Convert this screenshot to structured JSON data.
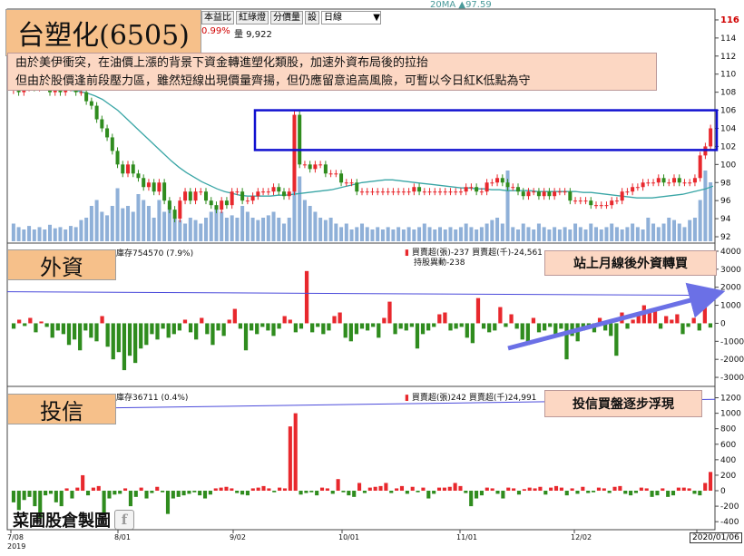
{
  "title": "台塑化(6505)",
  "note_lines": [
    "由於美伊衝突，在油價上漲的背景下資金轉進塑化類股，加速外資布局後的拉抬",
    "但由於股價逢前段壓力區，雖然短線出現價量齊揚，但仍應留意追高風險，可暫以今日紅K低點為守"
  ],
  "toolbar": {
    "btn1": "本益比",
    "btn2": "紅綠燈",
    "btn3": "分價量",
    "btn4": "設",
    "period": "日線",
    "period_arrow": "▼"
  },
  "header_info": {
    "pct": "0.99%",
    "vol": "量 9,922",
    "ma_label": "20MA ▲97.59"
  },
  "panels": {
    "foreign": {
      "label": "外資",
      "stock": "庫存754570 (7.9%)",
      "legend1": "買賣超(張)-237 買賣超(千)-24,561",
      "legend2": "持股異動-238",
      "callout": "站上月線後外資轉買"
    },
    "trust": {
      "label": "投信",
      "stock": "庫存36711 (0.4%)",
      "legend1": "買賣超(張)242 買賣超(千)24,991",
      "callout": "投信買盤逐步浮現"
    }
  },
  "watermark": "菜圃股倉製圖",
  "watermark_icon": "facebook-icon",
  "last_date": "2020/01/06",
  "colors": {
    "up": "#e8282d",
    "down": "#2f8c1e",
    "ma": "#3aa6a6",
    "volume": "#8fb0d8",
    "holding": "#4b4bdb",
    "box": "#1010d0",
    "arrow": "#6b70e6",
    "price_tag": "#d00000"
  },
  "chart_data": [
    {
      "type": "candlestick",
      "title": "",
      "x_ticks": [
        "7/08\n2019",
        "8/01",
        "9/02",
        "10/01",
        "11/01",
        "12/02",
        "2020"
      ],
      "y_ticks": [
        92,
        94,
        96,
        98,
        100,
        102,
        104,
        106,
        108,
        110,
        112,
        114,
        116
      ],
      "ylim": [
        91.5,
        117
      ],
      "last_price": 116,
      "close": [
        108.5,
        108,
        108.5,
        109,
        108.5,
        109,
        108.8,
        108,
        108.5,
        108,
        108.5,
        108.5,
        108,
        108,
        107,
        106.5,
        105,
        104,
        103,
        101.5,
        100,
        99,
        100,
        99,
        98.5,
        97.5,
        98,
        97,
        98,
        96,
        95,
        94,
        96,
        97,
        96,
        97,
        97,
        96,
        95.5,
        95,
        96,
        95.5,
        97,
        97,
        96,
        96,
        96.5,
        97,
        97,
        97,
        97.5,
        97,
        96.5,
        97,
        105.5,
        100,
        100,
        99.5,
        100,
        100,
        99,
        99,
        99,
        98,
        98,
        98,
        97,
        97,
        97,
        97,
        97,
        97,
        97,
        97,
        97,
        97,
        97,
        97.5,
        97,
        97,
        97,
        97,
        97,
        97,
        97,
        97,
        97,
        97.5,
        97.5,
        97,
        97,
        98,
        98,
        98.5,
        98,
        97.5,
        97.5,
        97,
        96.5,
        97,
        97,
        96.5,
        97,
        96.5,
        97,
        97,
        97,
        96,
        96,
        96,
        96,
        95.5,
        95.5,
        95.5,
        95.5,
        96,
        96,
        97,
        97,
        97.5,
        97.5,
        98,
        98,
        98,
        98.5,
        98,
        98,
        98.5,
        98,
        98,
        98,
        98.5,
        101,
        102,
        104
      ],
      "ma20": [
        108.8,
        108.7,
        108.6,
        108.6,
        108.5,
        108.5,
        108.4,
        108.3,
        108.2,
        108.1,
        107.9,
        107.6,
        107.2,
        106.6,
        106,
        105.2,
        104.4,
        103.6,
        102.8,
        102,
        101.2,
        100.4,
        99.7,
        99.1,
        98.6,
        98.1,
        97.7,
        97.3,
        97,
        96.8,
        96.6,
        96.5,
        96.5,
        96.5,
        96.5,
        96.6,
        96.6,
        96.7,
        96.8,
        96.9,
        97,
        97.1,
        97.2,
        97.4,
        97.6,
        97.8,
        98,
        98.1,
        98.2,
        98.3,
        98.3,
        98.2,
        98.1,
        98,
        97.9,
        97.8,
        97.7,
        97.6,
        97.5,
        97.4,
        97.4,
        97.3,
        97.3,
        97.2,
        97.2,
        97.1,
        97.1,
        97.1,
        97.1,
        97,
        97,
        97,
        97,
        97,
        97,
        96.9,
        96.9,
        96.8,
        96.7,
        96.6,
        96.5,
        96.4,
        96.3,
        96.3,
        96.3,
        96.4,
        96.5,
        96.6,
        96.7,
        96.9,
        97.1,
        97.3,
        97.6
      ],
      "volume_relative": [
        0.15,
        0.12,
        0.1,
        0.13,
        0.1,
        0.12,
        0.1,
        0.14,
        0.11,
        0.12,
        0.1,
        0.13,
        0.12,
        0.18,
        0.2,
        0.3,
        0.35,
        0.25,
        0.22,
        0.3,
        0.45,
        0.28,
        0.3,
        0.25,
        0.4,
        0.35,
        0.3,
        0.2,
        0.35,
        0.25,
        0.3,
        0.2,
        0.18,
        0.15,
        0.2,
        0.18,
        0.15,
        0.2,
        0.25,
        0.3,
        0.25,
        0.2,
        0.22,
        0.2,
        0.3,
        0.25,
        0.2,
        0.18,
        0.2,
        0.22,
        0.25,
        0.2,
        0.15,
        0.2,
        1.0,
        0.55,
        0.35,
        0.3,
        0.25,
        0.2,
        0.18,
        0.2,
        0.15,
        0.12,
        0.15,
        0.1,
        0.12,
        0.15,
        0.12,
        0.1,
        0.12,
        0.1,
        0.12,
        0.1,
        0.12,
        0.1,
        0.12,
        0.1,
        0.12,
        0.15,
        0.12,
        0.1,
        0.12,
        0.1,
        0.12,
        0.1,
        0.12,
        0.15,
        0.12,
        0.1,
        0.12,
        0.15,
        0.18,
        0.2,
        0.15,
        0.6,
        0.12,
        0.1,
        0.15,
        0.12,
        0.1,
        0.15,
        0.12,
        0.1,
        0.12,
        0.1,
        0.12,
        0.1,
        0.15,
        0.12,
        0.1,
        0.15,
        0.12,
        0.1,
        0.12,
        0.15,
        0.12,
        0.1,
        0.12,
        0.15,
        0.12,
        0.1,
        0.2,
        0.15,
        0.12,
        0.15,
        0.2,
        0.18,
        0.15,
        0.12,
        0.18,
        0.2,
        0.35,
        0.6,
        0.5
      ]
    },
    {
      "type": "bar",
      "title": "",
      "y_ticks": [
        -3000,
        -2000,
        -1000,
        0,
        1000,
        2000,
        3000,
        4000
      ],
      "ylim": [
        -3400,
        4300
      ],
      "values": [
        -300,
        200,
        -150,
        300,
        -500,
        100,
        -200,
        -800,
        -400,
        -600,
        -1200,
        -900,
        -1500,
        -400,
        -800,
        -1000,
        400,
        -1300,
        -2000,
        -1600,
        -2600,
        -1800,
        -2200,
        -1400,
        -1200,
        -600,
        -900,
        -300,
        -800,
        -600,
        -400,
        200,
        -500,
        -900,
        300,
        -600,
        -1200,
        -400,
        -700,
        200,
        800,
        -300,
        -1500,
        -400,
        -600,
        -200,
        -400,
        -700,
        -300,
        400,
        200,
        -500,
        -300,
        2900,
        -500,
        -200,
        -600,
        -400,
        400,
        600,
        -800,
        -1000,
        -600,
        -300,
        -400,
        -200,
        -800,
        300,
        1200,
        -600,
        -300,
        -400,
        -200,
        -1400,
        -600,
        -400,
        -200,
        500,
        600,
        -400,
        -300,
        -200,
        -800,
        -1100,
        1400,
        -300,
        -500,
        -400,
        900,
        -200,
        500,
        -300,
        -900,
        -1200,
        300,
        -500,
        -400,
        -200,
        -600,
        -300,
        -2000,
        -700,
        -1000,
        -400,
        -300,
        -500,
        300,
        -400,
        -700,
        -1800,
        600,
        -300,
        200,
        500,
        1000,
        600,
        800,
        -300,
        400,
        200,
        500,
        -600,
        -200,
        300,
        -400,
        1000,
        -237
      ],
      "holding_line": {
        "start": 1750,
        "end": 1550
      }
    },
    {
      "type": "bar",
      "title": "",
      "y_ticks": [
        -400,
        -200,
        0,
        200,
        400,
        600,
        800,
        1000,
        1200
      ],
      "ylim": [
        -480,
        1300
      ],
      "values": [
        -150,
        -250,
        -120,
        -80,
        -200,
        -350,
        -60,
        -40,
        -150,
        -200,
        30,
        -100,
        40,
        200,
        -60,
        40,
        60,
        -300,
        -100,
        -50,
        -40,
        30,
        -200,
        -80,
        40,
        -100,
        -30,
        50,
        -20,
        -300,
        -100,
        -80,
        -60,
        -40,
        -20,
        -60,
        -100,
        -50,
        30,
        40,
        50,
        30,
        -30,
        -50,
        -60,
        30,
        40,
        60,
        30,
        -20,
        40,
        30,
        830,
        1000,
        -50,
        -30,
        -20,
        -60,
        40,
        30,
        -40,
        150,
        -20,
        -60,
        -80,
        100,
        -30,
        40,
        50,
        60,
        100,
        -30,
        30,
        60,
        -40,
        50,
        -20,
        40,
        -100,
        -40,
        40,
        40,
        50,
        100,
        60,
        -30,
        -200,
        -100,
        -60,
        40,
        30,
        -40,
        -100,
        40,
        30,
        -50,
        20,
        40,
        30,
        50,
        -50,
        40,
        60,
        40,
        -60,
        30,
        -40,
        50,
        -30,
        -20,
        40,
        30,
        -30,
        50,
        60,
        -40,
        -60,
        -30,
        40,
        30,
        -80,
        -60,
        30,
        -80,
        -60,
        40,
        40,
        30,
        -40,
        -60,
        100,
        242
      ],
      "holding_line": {
        "start": 1050,
        "end": 1180
      }
    }
  ]
}
